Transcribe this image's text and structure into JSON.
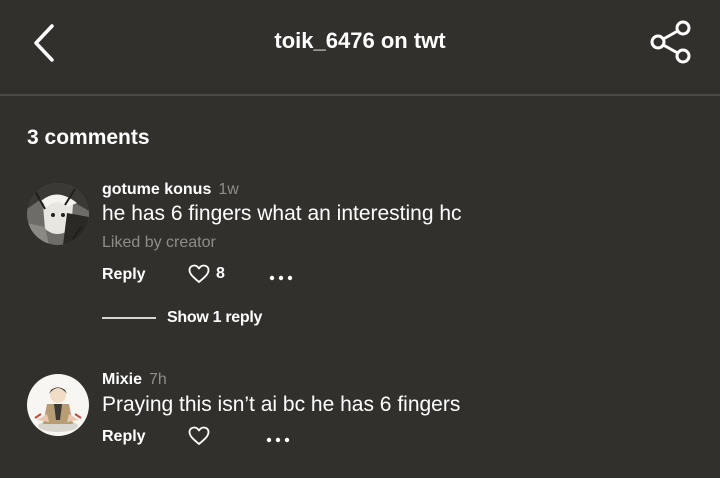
{
  "header": {
    "title": "toik_6476 on twt"
  },
  "comments_count_label": "3 comments",
  "comments": [
    {
      "username": "gotume konus",
      "time": "1w",
      "text": "he has 6 fingers what an interesting hc",
      "liked_by": "Liked by creator",
      "reply_label": "Reply",
      "like_count": "8",
      "show_replies_label": "Show 1 reply"
    },
    {
      "username": "Mixie",
      "time": "7h",
      "text": "Praying this isn’t ai bc he has 6 fingers",
      "reply_label": "Reply"
    }
  ],
  "colors": {
    "background": "#31302c",
    "divider": "#4a4945",
    "muted_text": "#8f8d88",
    "primary_text": "#ffffff"
  },
  "icons": [
    "chevron-left-icon",
    "share-icon",
    "heart-outline-icon",
    "more-dots-icon"
  ]
}
